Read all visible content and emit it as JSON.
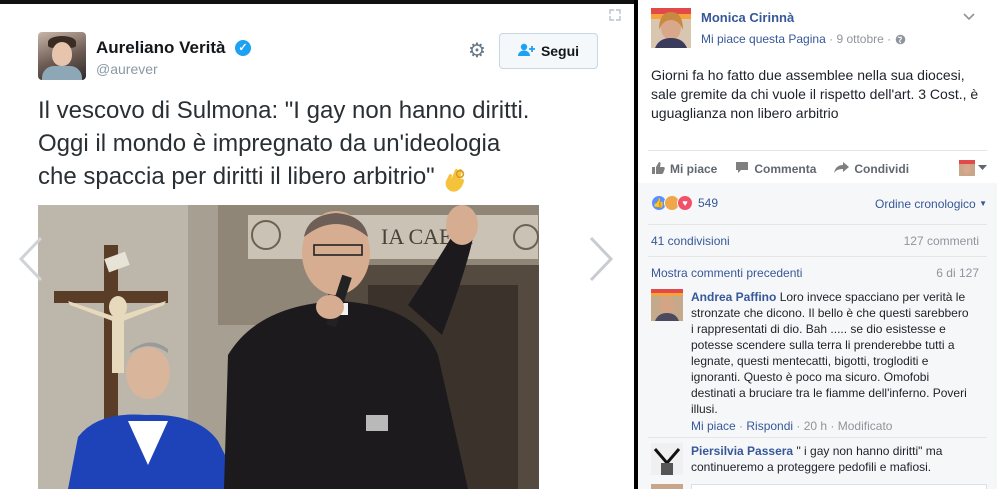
{
  "tweet": {
    "author_name": "Aureliano Verità",
    "handle": "@aurever",
    "follow_label": "Segui",
    "text_lines": [
      "Il vescovo di Sulmona: \"I gay non hanno diritti.",
      "Oggi il mondo è impregnato da un'ideologia",
      "che spaccia per diritti il libero arbitrio\""
    ],
    "photo_inscription": "IA CAELI"
  },
  "facebook": {
    "author": "Monica Cirinnà",
    "like_page": "Mi piace questa Pagina",
    "date": "9 ottobre",
    "separator": "·",
    "post_text": "Giorni fa ho fatto due assemblee nella sua diocesi, sale gremite da chi vuole il rispetto dell'art. 3 Cost., è uguaglianza non libero arbitrio",
    "actions": {
      "like": "Mi piace",
      "comment": "Commenta",
      "share": "Condividi"
    },
    "reactions_count": "549",
    "order": "Ordine cronologico",
    "shares": "41 condivisioni",
    "comments_total": "127 commenti",
    "show_previous": "Mostra commenti precedenti",
    "page_count": "6 di 127",
    "comments": [
      {
        "name": "Andrea Paffino",
        "text": "Loro invece spacciano per verità le stronzate che dicono. Il bello è che questi sarebbero i rappresentati di dio. Bah ..... se dio esistesse e potesse scendere sulla terra li prenderebbe tutti a legnate, questi mentecatti, bigotti, trogloditi e ignoranti. Questo è poco ma sicuro. Omofobi destinati a bruciare tra le fiamme dell'inferno. Poveri illusi.",
        "meta_like": "Mi piace",
        "meta_reply": "Rispondi",
        "meta_time": "20 h",
        "meta_edit": "Modificato"
      },
      {
        "name": "Piersilvia Passera",
        "text": "\" i gay non hanno diritti\" ma continueremo a proteggere pedofili e mafiosi."
      }
    ]
  }
}
